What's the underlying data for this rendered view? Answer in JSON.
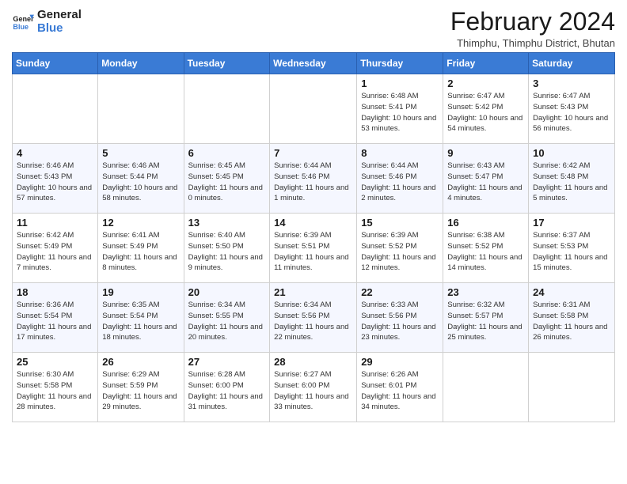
{
  "logo": {
    "line1": "General",
    "line2": "Blue"
  },
  "header": {
    "month_year": "February 2024",
    "location": "Thimphu, Thimphu District, Bhutan"
  },
  "weekdays": [
    "Sunday",
    "Monday",
    "Tuesday",
    "Wednesday",
    "Thursday",
    "Friday",
    "Saturday"
  ],
  "weeks": [
    [
      {
        "day": "",
        "info": ""
      },
      {
        "day": "",
        "info": ""
      },
      {
        "day": "",
        "info": ""
      },
      {
        "day": "",
        "info": ""
      },
      {
        "day": "1",
        "info": "Sunrise: 6:48 AM\nSunset: 5:41 PM\nDaylight: 10 hours and 53 minutes."
      },
      {
        "day": "2",
        "info": "Sunrise: 6:47 AM\nSunset: 5:42 PM\nDaylight: 10 hours and 54 minutes."
      },
      {
        "day": "3",
        "info": "Sunrise: 6:47 AM\nSunset: 5:43 PM\nDaylight: 10 hours and 56 minutes."
      }
    ],
    [
      {
        "day": "4",
        "info": "Sunrise: 6:46 AM\nSunset: 5:43 PM\nDaylight: 10 hours and 57 minutes."
      },
      {
        "day": "5",
        "info": "Sunrise: 6:46 AM\nSunset: 5:44 PM\nDaylight: 10 hours and 58 minutes."
      },
      {
        "day": "6",
        "info": "Sunrise: 6:45 AM\nSunset: 5:45 PM\nDaylight: 11 hours and 0 minutes."
      },
      {
        "day": "7",
        "info": "Sunrise: 6:44 AM\nSunset: 5:46 PM\nDaylight: 11 hours and 1 minute."
      },
      {
        "day": "8",
        "info": "Sunrise: 6:44 AM\nSunset: 5:46 PM\nDaylight: 11 hours and 2 minutes."
      },
      {
        "day": "9",
        "info": "Sunrise: 6:43 AM\nSunset: 5:47 PM\nDaylight: 11 hours and 4 minutes."
      },
      {
        "day": "10",
        "info": "Sunrise: 6:42 AM\nSunset: 5:48 PM\nDaylight: 11 hours and 5 minutes."
      }
    ],
    [
      {
        "day": "11",
        "info": "Sunrise: 6:42 AM\nSunset: 5:49 PM\nDaylight: 11 hours and 7 minutes."
      },
      {
        "day": "12",
        "info": "Sunrise: 6:41 AM\nSunset: 5:49 PM\nDaylight: 11 hours and 8 minutes."
      },
      {
        "day": "13",
        "info": "Sunrise: 6:40 AM\nSunset: 5:50 PM\nDaylight: 11 hours and 9 minutes."
      },
      {
        "day": "14",
        "info": "Sunrise: 6:39 AM\nSunset: 5:51 PM\nDaylight: 11 hours and 11 minutes."
      },
      {
        "day": "15",
        "info": "Sunrise: 6:39 AM\nSunset: 5:52 PM\nDaylight: 11 hours and 12 minutes."
      },
      {
        "day": "16",
        "info": "Sunrise: 6:38 AM\nSunset: 5:52 PM\nDaylight: 11 hours and 14 minutes."
      },
      {
        "day": "17",
        "info": "Sunrise: 6:37 AM\nSunset: 5:53 PM\nDaylight: 11 hours and 15 minutes."
      }
    ],
    [
      {
        "day": "18",
        "info": "Sunrise: 6:36 AM\nSunset: 5:54 PM\nDaylight: 11 hours and 17 minutes."
      },
      {
        "day": "19",
        "info": "Sunrise: 6:35 AM\nSunset: 5:54 PM\nDaylight: 11 hours and 18 minutes."
      },
      {
        "day": "20",
        "info": "Sunrise: 6:34 AM\nSunset: 5:55 PM\nDaylight: 11 hours and 20 minutes."
      },
      {
        "day": "21",
        "info": "Sunrise: 6:34 AM\nSunset: 5:56 PM\nDaylight: 11 hours and 22 minutes."
      },
      {
        "day": "22",
        "info": "Sunrise: 6:33 AM\nSunset: 5:56 PM\nDaylight: 11 hours and 23 minutes."
      },
      {
        "day": "23",
        "info": "Sunrise: 6:32 AM\nSunset: 5:57 PM\nDaylight: 11 hours and 25 minutes."
      },
      {
        "day": "24",
        "info": "Sunrise: 6:31 AM\nSunset: 5:58 PM\nDaylight: 11 hours and 26 minutes."
      }
    ],
    [
      {
        "day": "25",
        "info": "Sunrise: 6:30 AM\nSunset: 5:58 PM\nDaylight: 11 hours and 28 minutes."
      },
      {
        "day": "26",
        "info": "Sunrise: 6:29 AM\nSunset: 5:59 PM\nDaylight: 11 hours and 29 minutes."
      },
      {
        "day": "27",
        "info": "Sunrise: 6:28 AM\nSunset: 6:00 PM\nDaylight: 11 hours and 31 minutes."
      },
      {
        "day": "28",
        "info": "Sunrise: 6:27 AM\nSunset: 6:00 PM\nDaylight: 11 hours and 33 minutes."
      },
      {
        "day": "29",
        "info": "Sunrise: 6:26 AM\nSunset: 6:01 PM\nDaylight: 11 hours and 34 minutes."
      },
      {
        "day": "",
        "info": ""
      },
      {
        "day": "",
        "info": ""
      }
    ]
  ]
}
